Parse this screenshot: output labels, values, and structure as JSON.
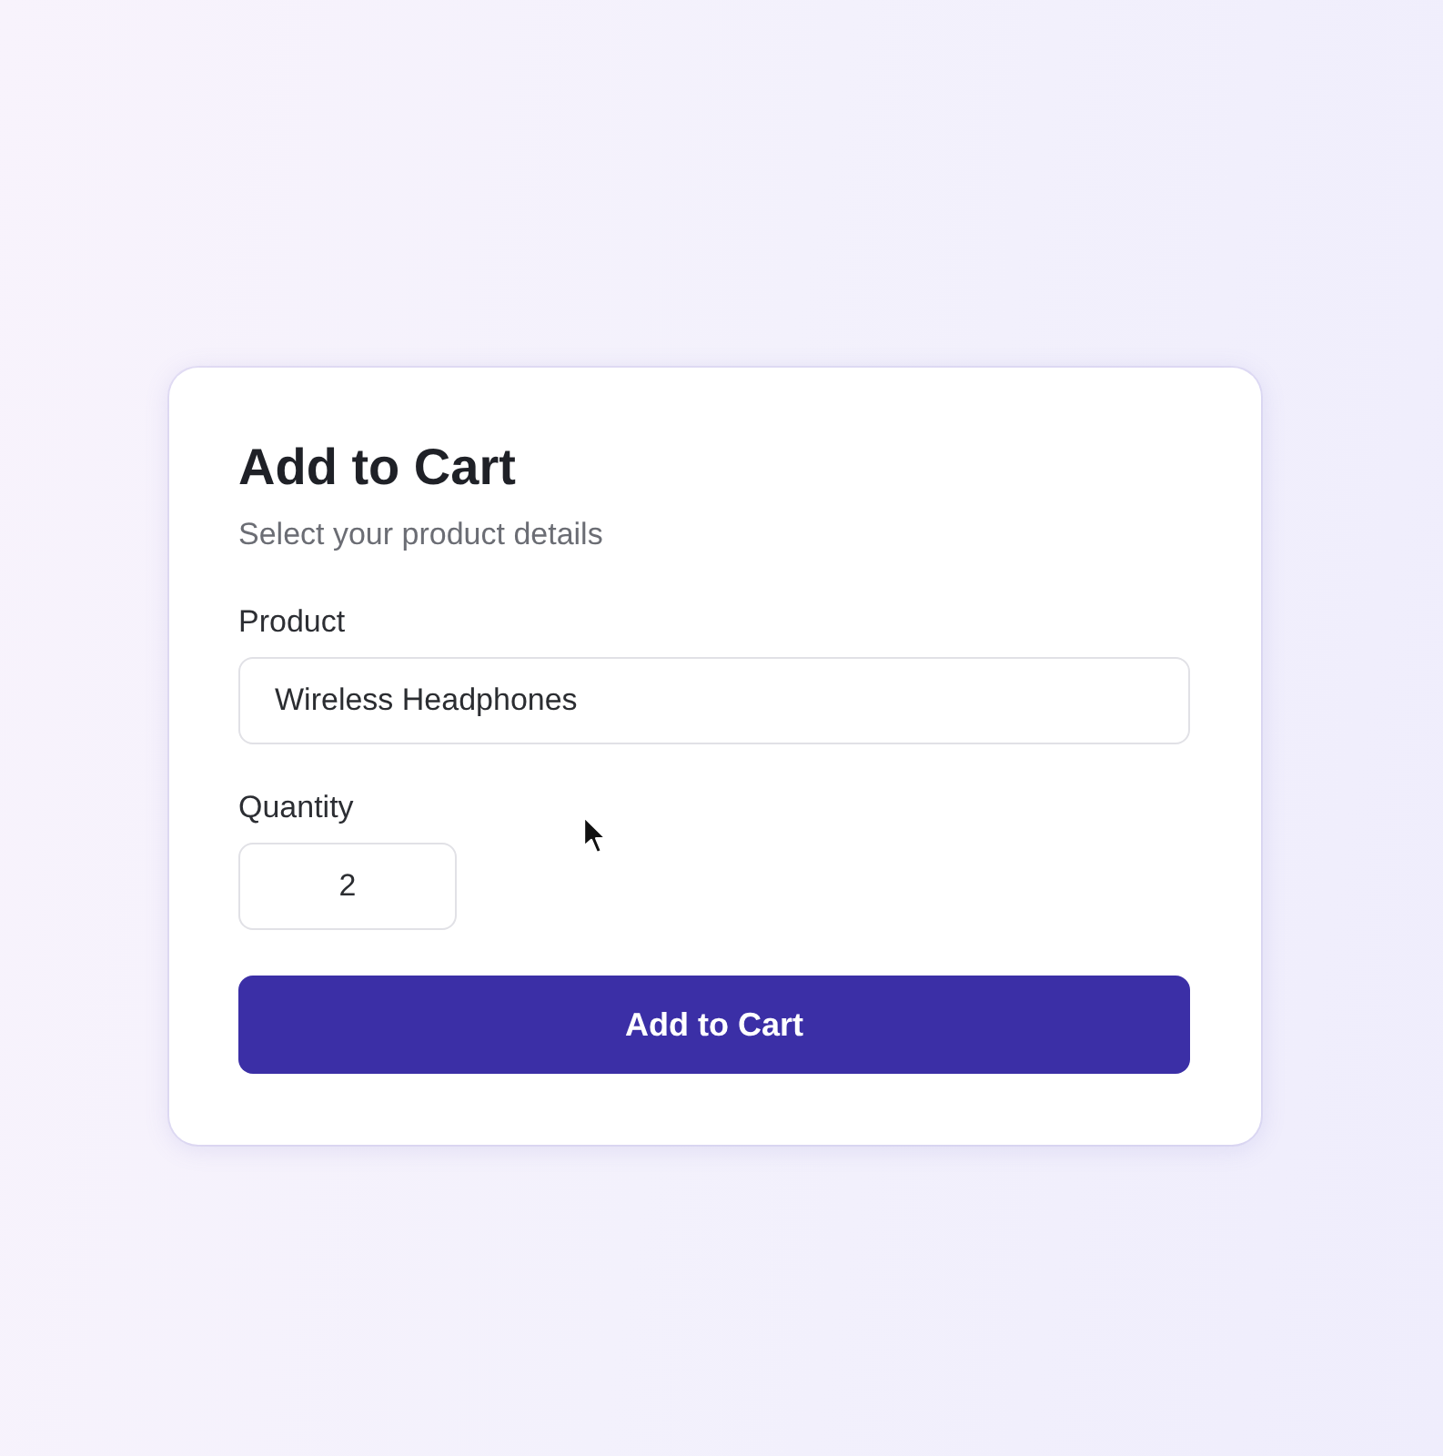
{
  "card": {
    "title": "Add to Cart",
    "subtitle": "Select your product details"
  },
  "fields": [
    {
      "kind": "text",
      "label": "Product",
      "value": "Wireless Headphones"
    },
    {
      "kind": "number",
      "label": "Quantity",
      "value": "2"
    }
  ],
  "button": {
    "label": "Add to Cart"
  }
}
